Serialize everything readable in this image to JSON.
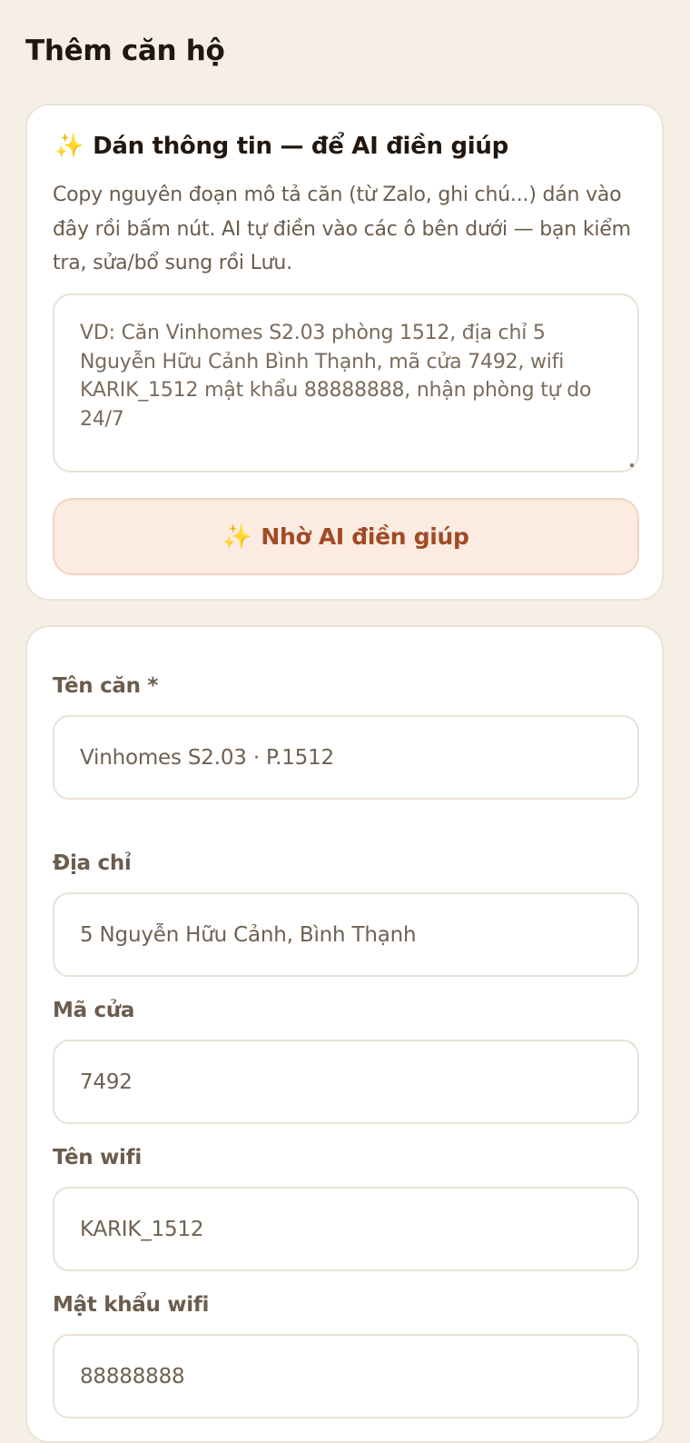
{
  "page": {
    "title": "Thêm căn hộ"
  },
  "ai_card": {
    "icon": "sparkles-icon",
    "sparkle_glyph": "✨",
    "title": "Dán thông tin — để AI điền giúp",
    "description": "Copy nguyên đoạn mô tả căn (từ Zalo, ghi chú...) dán vào đây rồi bấm nút. AI tự điền vào các ô bên dưới — bạn kiểm tra, sửa/bổ sung rồi Lưu.",
    "textarea_placeholder": "VD: Căn Vinhomes S2.03 phòng 1512, địa chỉ 5 Nguyễn Hữu Cảnh Bình Thạnh, mã cửa 7492, wifi KARIK_1512 mật khẩu 88888888, nhận phòng tự do 24/7",
    "button_label": "Nhờ AI điền giúp"
  },
  "form": {
    "fields": [
      {
        "label": "Tên căn *",
        "value": "Vinhomes S2.03 · P.1512"
      },
      {
        "label": "Địa chỉ",
        "value": "5 Nguyễn Hữu Cảnh, Bình Thạnh"
      },
      {
        "label": "Mã cửa",
        "value": "7492"
      },
      {
        "label": "Tên wifi",
        "value": "KARIK_1512"
      },
      {
        "label": "Mật khẩu wifi",
        "value": "88888888"
      }
    ]
  },
  "colors": {
    "background": "#f5efe6",
    "card": "#ffffff",
    "accent_text": "#a14a25",
    "accent_bg": "#fbebe0",
    "sparkle": "#f1b322"
  }
}
